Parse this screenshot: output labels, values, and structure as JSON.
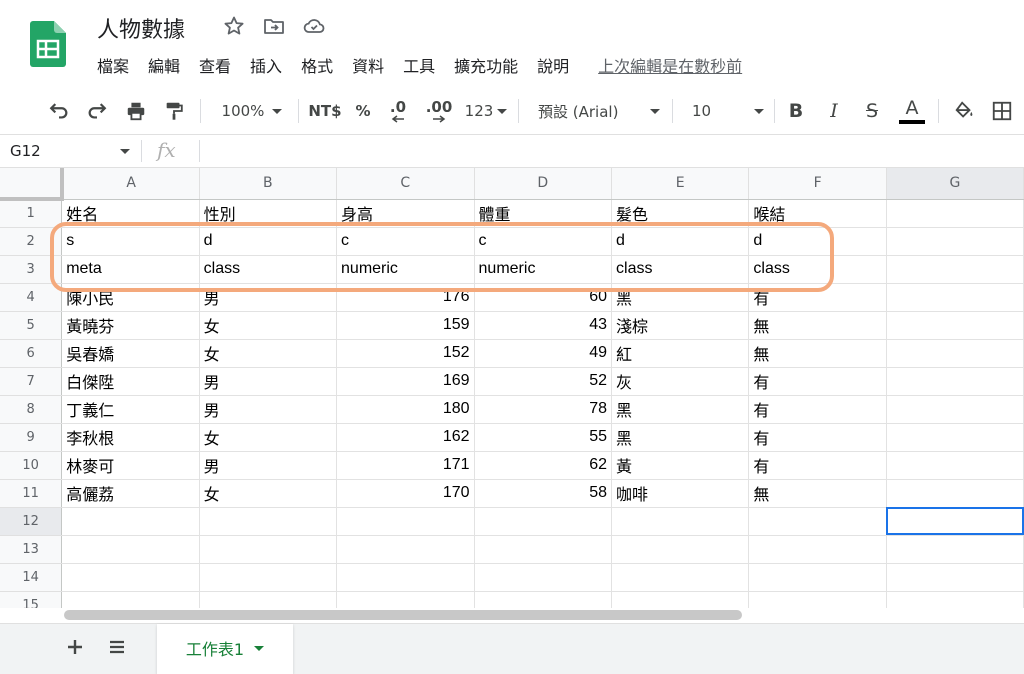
{
  "document": {
    "title": "人物數據"
  },
  "menu": {
    "items": [
      "檔案",
      "編輯",
      "查看",
      "插入",
      "格式",
      "資料",
      "工具",
      "擴充功能",
      "說明"
    ],
    "last_edit": "上次編輯是在數秒前"
  },
  "toolbar": {
    "zoom": "100%",
    "currency": "NT$",
    "percent": "%",
    "decrease_decimal": ".0",
    "increase_decimal": ".00",
    "more_formats": "123",
    "font": "預設 (Arial)",
    "font_size": "10",
    "bold": "B",
    "italic": "I",
    "strikethrough": "S",
    "text_color_letter": "A"
  },
  "formula_bar": {
    "cell_ref": "G12",
    "fx": "fx"
  },
  "grid": {
    "columns": [
      "A",
      "B",
      "C",
      "D",
      "E",
      "F",
      "G"
    ],
    "row_numbers": [
      "1",
      "2",
      "3",
      "4",
      "5",
      "6",
      "7",
      "8",
      "9",
      "10",
      "11",
      "12",
      "13",
      "14",
      "15"
    ],
    "rows": [
      [
        "姓名",
        "性別",
        "身高",
        "體重",
        "髮色",
        "喉結",
        ""
      ],
      [
        "s",
        "d",
        "c",
        "c",
        "d",
        "d",
        ""
      ],
      [
        "meta",
        "class",
        "numeric",
        "numeric",
        "class",
        "class",
        ""
      ],
      [
        "陳小民",
        "男",
        "176",
        "60",
        "黑",
        "有",
        ""
      ],
      [
        "黃曉芬",
        "女",
        "159",
        "43",
        "淺棕",
        "無",
        ""
      ],
      [
        "吳春嬌",
        "女",
        "152",
        "49",
        "紅",
        "無",
        ""
      ],
      [
        "白傑陞",
        "男",
        "169",
        "52",
        "灰",
        "有",
        ""
      ],
      [
        "丁義仁",
        "男",
        "180",
        "78",
        "黑",
        "有",
        ""
      ],
      [
        "李秋根",
        "女",
        "162",
        "55",
        "黑",
        "有",
        ""
      ],
      [
        "林麥可",
        "男",
        "171",
        "62",
        "黃",
        "有",
        ""
      ],
      [
        "高儷荔",
        "女",
        "170",
        "58",
        "咖啡",
        "無",
        ""
      ],
      [
        "",
        "",
        "",
        "",
        "",
        "",
        ""
      ],
      [
        "",
        "",
        "",
        "",
        "",
        "",
        ""
      ],
      [
        "",
        "",
        "",
        "",
        "",
        "",
        ""
      ],
      [
        "",
        "",
        "",
        "",
        "",
        "",
        ""
      ]
    ],
    "numeric_columns": [
      2,
      3
    ],
    "selected_cell": {
      "row": 11,
      "col": 6
    }
  },
  "sheets": {
    "tabs": [
      {
        "label": "工作表1"
      }
    ]
  },
  "colors": {
    "brand_green": "#188038",
    "selection_blue": "#1a73e8",
    "highlight_orange": "#f4a97c",
    "sheets_logo": "#23a566"
  },
  "icons": {
    "logo": "google-sheets-logo",
    "star": "star-icon",
    "move": "move-to-folder-icon",
    "cloud": "cloud-saved-icon",
    "undo": "undo-icon",
    "redo": "redo-icon",
    "print": "print-icon",
    "paint_format": "paint-format-icon",
    "fill_color": "fill-color-icon",
    "borders": "borders-icon",
    "add_sheet": "plus-icon",
    "all_sheets": "list-icon"
  }
}
